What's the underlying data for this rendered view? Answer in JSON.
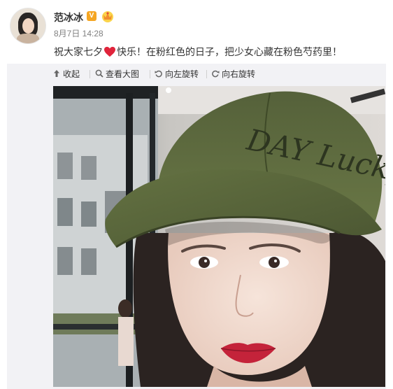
{
  "post": {
    "author": "范冰冰",
    "verified_badge": "V",
    "timestamp": "8月7日 14:28",
    "text_before_emoji": "祝大家七夕",
    "emoji": "heart",
    "text_after_emoji": "快乐！在粉红色的日子，把少女心藏在粉色芍药里！"
  },
  "toolbar": {
    "collapse_label": "收起",
    "view_large_label": "查看大图",
    "rotate_left_label": "向左旋转",
    "rotate_right_label": "向右旋转"
  },
  "cap_text": "DAY Lucky",
  "colors": {
    "toolbar_bg": "#f2f2f5",
    "cap_green": "#5c6a3a",
    "badge_orange": "#f5a623",
    "heart_red": "#e0243b"
  }
}
